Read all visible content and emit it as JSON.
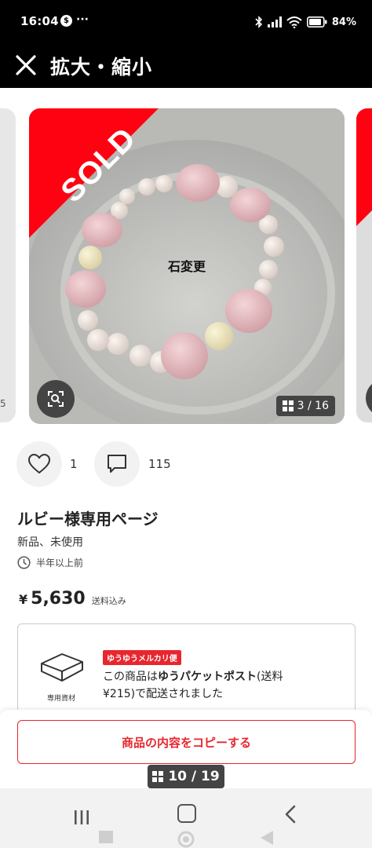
{
  "status_bar": {
    "time": "16:04",
    "app_icon_letter": "$",
    "more": "···",
    "battery": "84%"
  },
  "header": {
    "title": "拡大・縮小"
  },
  "image": {
    "sold_label": "SOLD",
    "overlay_label": "石変更",
    "counter": "3 / 16",
    "prev_partial_label": "5"
  },
  "actions": {
    "like_count": "1",
    "comment_count": "115"
  },
  "item": {
    "title": "ルビー様専用ページ",
    "condition": "新品、未使用",
    "listed": "半年以上前",
    "price_currency": "¥",
    "price": "5,630",
    "price_note": "送料込み"
  },
  "shipping": {
    "pack_label": "専用資材",
    "badge": "ゆうゆうメルカリ便",
    "desc_line1_a": "この商品は",
    "desc_line1_b": "ゆうパケットポスト",
    "desc_line1_c": "(送料",
    "desc_line2": "¥215)で配送されました"
  },
  "copy_button": "商品の内容をコピーする",
  "pager": "10 / 19",
  "colors": {
    "accent": "#e8262e",
    "sold": "#ff0211",
    "badge_bg": "#444444"
  }
}
